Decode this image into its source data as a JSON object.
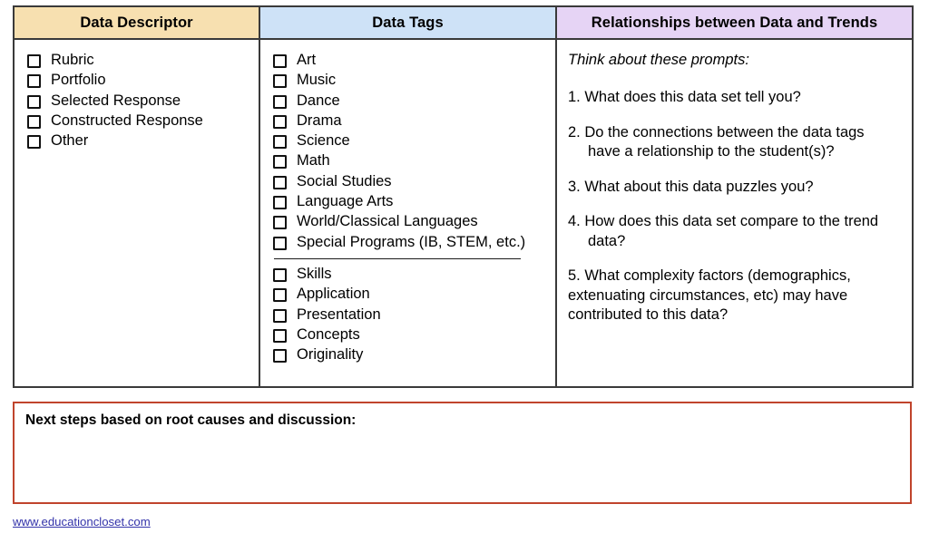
{
  "table": {
    "columns": [
      {
        "id": "data-descriptor",
        "header": "Data Descriptor",
        "header_color": "#f7e0b0"
      },
      {
        "id": "data-tags",
        "header": "Data Tags",
        "header_color": "#cee2f7"
      },
      {
        "id": "relationships",
        "header": "Relationships between Data and Trends",
        "header_color": "#e6d4f5"
      }
    ]
  },
  "descriptor": {
    "items": [
      {
        "label": "Rubric"
      },
      {
        "label": "Portfolio"
      },
      {
        "label": "Selected Response"
      },
      {
        "label": "Constructed Response"
      },
      {
        "label": "Other"
      }
    ]
  },
  "tags": {
    "group_subjects": [
      {
        "label": "Art"
      },
      {
        "label": "Music"
      },
      {
        "label": "Dance"
      },
      {
        "label": "Drama"
      },
      {
        "label": "Science"
      },
      {
        "label": "Math"
      },
      {
        "label": "Social Studies"
      },
      {
        "label": "Language Arts"
      },
      {
        "label": "World/Classical Languages"
      },
      {
        "label": "Special Programs (IB, STEM, etc.)"
      }
    ],
    "group_skills": [
      {
        "label": "Skills"
      },
      {
        "label": "Application"
      },
      {
        "label": "Presentation"
      },
      {
        "label": "Concepts"
      },
      {
        "label": "Originality"
      }
    ]
  },
  "relationships": {
    "intro": "Think about these prompts:",
    "prompts": [
      {
        "text": "1. What does this data set tell you?",
        "hanging_indent": true
      },
      {
        "text": "2. Do the connections between the data tags have a relationship to the student(s)?",
        "hanging_indent": true
      },
      {
        "text": "3. What about this data puzzles you?",
        "hanging_indent": true
      },
      {
        "text": "4. How does this data set compare to the trend data?",
        "hanging_indent": true
      },
      {
        "text": "5. What complexity factors (demographics, extenuating circumstances, etc) may have contributed to this data?",
        "hanging_indent": false
      }
    ]
  },
  "next_steps": {
    "title": "Next steps based on root causes and discussion:",
    "value": "",
    "placeholder": "",
    "border_color": "#c0442c"
  },
  "footer": {
    "link_text": "www.educationcloset.com",
    "link_color": "#3333aa"
  }
}
